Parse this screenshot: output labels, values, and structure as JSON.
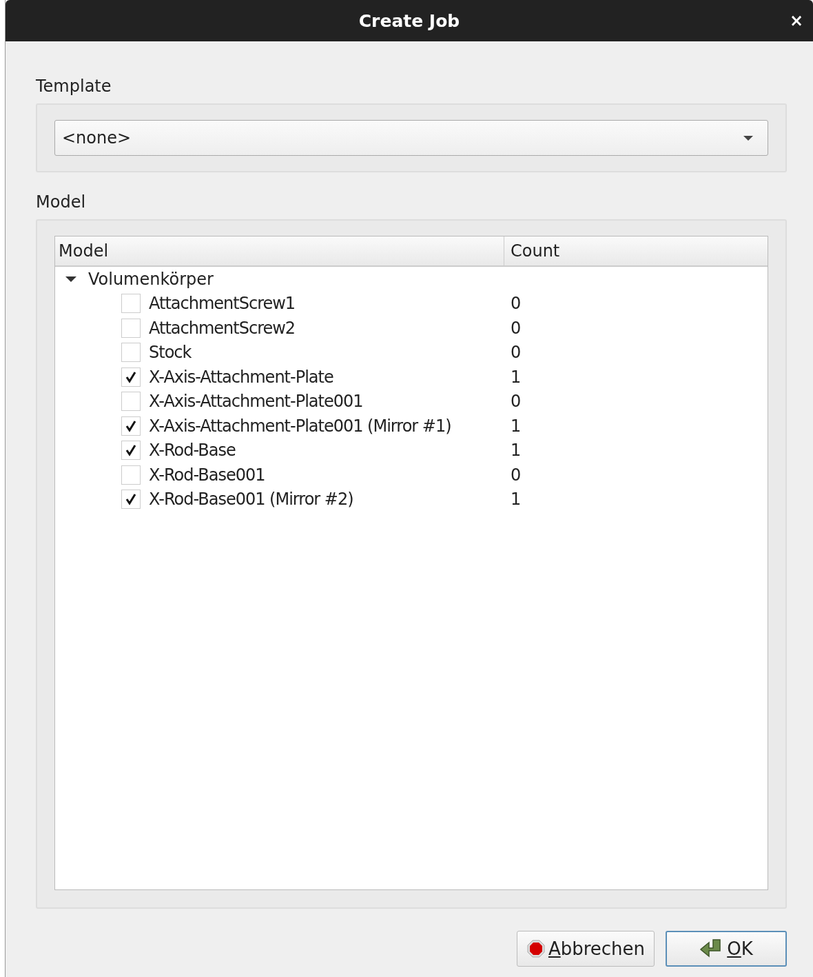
{
  "window": {
    "title": "Create Job",
    "close": "×"
  },
  "template": {
    "label": "Template",
    "value": "<none>"
  },
  "model": {
    "label": "Model",
    "columns": [
      "Model",
      "Count"
    ],
    "tree": [
      {
        "name": "Volumenkörper",
        "expanded": true,
        "children": [
          {
            "name": "AttachmentScrew1",
            "checked": false,
            "count": "0"
          },
          {
            "name": "AttachmentScrew2",
            "checked": false,
            "count": "0"
          },
          {
            "name": "Stock",
            "checked": false,
            "count": "0"
          },
          {
            "name": "X-Axis-Attachment-Plate",
            "checked": true,
            "count": "1"
          },
          {
            "name": "X-Axis-Attachment-Plate001",
            "checked": false,
            "count": "0"
          },
          {
            "name": "X-Axis-Attachment-Plate001 (Mirror #1)",
            "checked": true,
            "count": "1"
          },
          {
            "name": "X-Rod-Base",
            "checked": true,
            "count": "1"
          },
          {
            "name": "X-Rod-Base001",
            "checked": false,
            "count": "0"
          },
          {
            "name": "X-Rod-Base001 (Mirror #2)",
            "checked": true,
            "count": "1"
          }
        ]
      }
    ]
  },
  "buttons": [
    {
      "label": "Abbrechen",
      "kind": "cancel"
    },
    {
      "label": "OK",
      "kind": "ok"
    }
  ]
}
